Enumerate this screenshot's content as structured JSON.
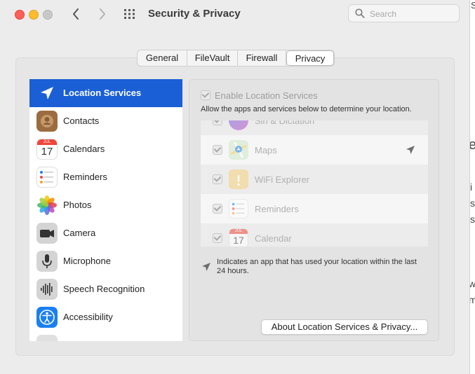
{
  "window": {
    "title": "Security & Privacy"
  },
  "search": {
    "placeholder": "Search"
  },
  "tabs": [
    {
      "label": "General",
      "selected": false
    },
    {
      "label": "FileVault",
      "selected": false
    },
    {
      "label": "Firewall",
      "selected": false
    },
    {
      "label": "Privacy",
      "selected": true
    }
  ],
  "sidebar": {
    "items": [
      {
        "label": "Location Services",
        "icon": "location-arrow-icon",
        "selected": true
      },
      {
        "label": "Contacts",
        "icon": "contacts-icon"
      },
      {
        "label": "Calendars",
        "icon": "calendar-icon",
        "month": "JUL",
        "day": "17"
      },
      {
        "label": "Reminders",
        "icon": "reminders-icon"
      },
      {
        "label": "Photos",
        "icon": "photos-icon"
      },
      {
        "label": "Camera",
        "icon": "camera-icon"
      },
      {
        "label": "Microphone",
        "icon": "microphone-icon"
      },
      {
        "label": "Speech Recognition",
        "icon": "waveform-icon"
      },
      {
        "label": "Accessibility",
        "icon": "accessibility-icon"
      }
    ]
  },
  "location": {
    "enable_label": "Enable Location Services",
    "enable_checked": true,
    "description": "Allow the apps and services below to determine your location.",
    "apps": [
      {
        "name": "Siri & Dictation",
        "checked": false,
        "icon": "siri-icon"
      },
      {
        "name": "Maps",
        "checked": true,
        "icon": "maps-icon",
        "recently_used": true
      },
      {
        "name": "WiFi Explorer",
        "checked": true,
        "icon": "wifi-explorer-icon"
      },
      {
        "name": "Reminders",
        "checked": true,
        "icon": "reminders-icon"
      },
      {
        "name": "Calendar",
        "checked": true,
        "icon": "calendar-icon",
        "month": "JUL",
        "day": "17"
      }
    ],
    "note": "Indicates an app that has used your location within the last 24 hours.",
    "about_button": "About Location Services & Privacy..."
  },
  "background_fragments": [
    "S",
    "e",
    "i",
    "s",
    "s",
    "w",
    "m"
  ],
  "colors": {
    "selection": "#1a5fd6",
    "close": "#ff5f57",
    "minimize": "#febc2e"
  }
}
